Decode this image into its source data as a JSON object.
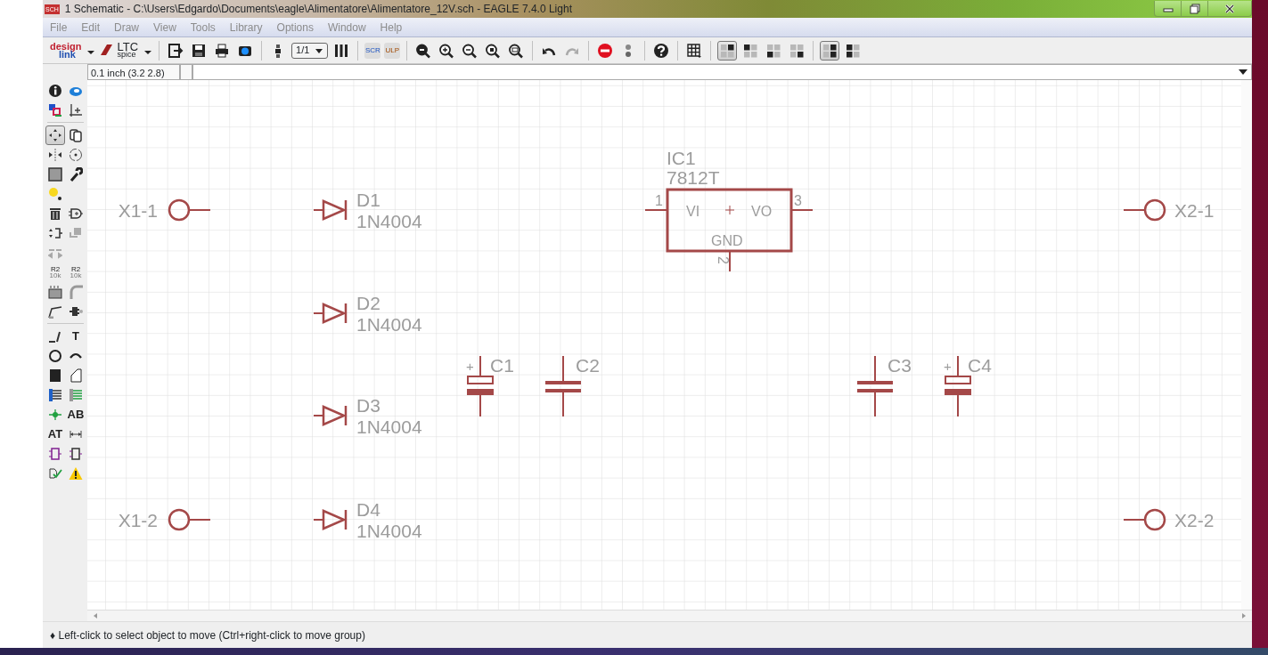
{
  "window": {
    "app_icon": "SCH",
    "title": "1 Schematic - C:\\Users\\Edgardo\\Documents\\eagle\\Alimentatore\\Alimentatore_12V.sch - EAGLE 7.4.0 Light"
  },
  "menu": [
    "File",
    "Edit",
    "Draw",
    "View",
    "Tools",
    "Library",
    "Options",
    "Window",
    "Help"
  ],
  "toolbar": {
    "logos": [
      {
        "lines": [
          "design",
          "link"
        ]
      },
      {
        "lines": [
          "LTC",
          "spice"
        ]
      }
    ],
    "zoom_select": "1/1",
    "script_buttons": [
      "SCR",
      "ULP"
    ],
    "layout_buttons": [
      {
        "selected": true
      },
      {
        "selected": false
      },
      {
        "selected": false
      },
      {
        "selected": false
      }
    ],
    "panel_buttons": [
      {
        "selected": true
      },
      {
        "selected": false
      }
    ]
  },
  "coordinate_field": {
    "value": "0.1 inch (3.2 2.8)"
  },
  "tool_rows": [
    [
      {
        "selected": false
      },
      {
        "selected": false
      }
    ],
    [
      {
        "selected": false
      },
      {
        "selected": false
      }
    ],
    [
      {
        "selected": true
      },
      {
        "selected": false
      }
    ],
    [
      {
        "selected": false
      },
      {
        "selected": false
      }
    ],
    [
      {
        "selected": false
      },
      {
        "selected": false
      }
    ],
    [
      {
        "selected": false
      }
    ],
    [
      {
        "selected": false
      },
      {
        "selected": false
      }
    ],
    [
      {
        "selected": false
      },
      {
        "selected": false
      }
    ],
    [
      {
        "selected": false
      }
    ],
    [
      {
        "selected": false,
        "lines": [
          "R2",
          "10k"
        ]
      },
      {
        "selected": false,
        "lines": [
          "R2",
          "10k"
        ]
      }
    ],
    [
      {
        "selected": false
      },
      {
        "selected": false
      }
    ],
    [
      {
        "selected": false
      },
      {
        "selected": false
      }
    ],
    [
      {
        "selected": false
      },
      {
        "selected": false,
        "lines": [
          "T"
        ]
      }
    ],
    [
      {
        "selected": false
      },
      {
        "selected": false
      }
    ],
    [
      {
        "selected": false
      },
      {
        "selected": false
      }
    ],
    [
      {
        "selected": false
      },
      {
        "selected": false
      }
    ],
    [
      {
        "selected": false
      },
      {
        "selected": false,
        "lines": [
          "AB"
        ]
      }
    ],
    [
      {
        "selected": false,
        "lines": [
          "AT"
        ]
      },
      {
        "selected": false
      }
    ],
    [
      {
        "selected": false
      },
      {
        "selected": false
      }
    ],
    [
      {
        "selected": false
      },
      {
        "selected": false
      }
    ]
  ],
  "schematic": {
    "parts": [
      {
        "kind": "regulator",
        "name": "IC1",
        "value": "7812T",
        "pins": [
          {
            "number": "1",
            "label": "VI"
          },
          {
            "number": "3",
            "label": "VO"
          },
          {
            "number": "2",
            "label": "GND"
          }
        ]
      },
      {
        "kind": "connector",
        "name": "X1-1"
      },
      {
        "kind": "diode",
        "name": "D1",
        "value": "1N4004"
      },
      {
        "kind": "connector",
        "name": "X2-1"
      },
      {
        "kind": "diode",
        "name": "D2",
        "value": "1N4004"
      },
      {
        "kind": "capacitor_polarized",
        "name": "C1",
        "polarity_mark": "+"
      },
      {
        "kind": "capacitor",
        "name": "C2"
      },
      {
        "kind": "capacitor",
        "name": "C3"
      },
      {
        "kind": "capacitor_polarized",
        "name": "C4",
        "polarity_mark": "+"
      },
      {
        "kind": "diode",
        "name": "D3",
        "value": "1N4004"
      },
      {
        "kind": "connector",
        "name": "X1-2"
      },
      {
        "kind": "diode",
        "name": "D4",
        "value": "1N4004"
      },
      {
        "kind": "connector",
        "name": "X2-2"
      }
    ]
  },
  "status_bar": {
    "message": "♦ Left-click to select object to move (Ctrl+right-click to move group)"
  }
}
